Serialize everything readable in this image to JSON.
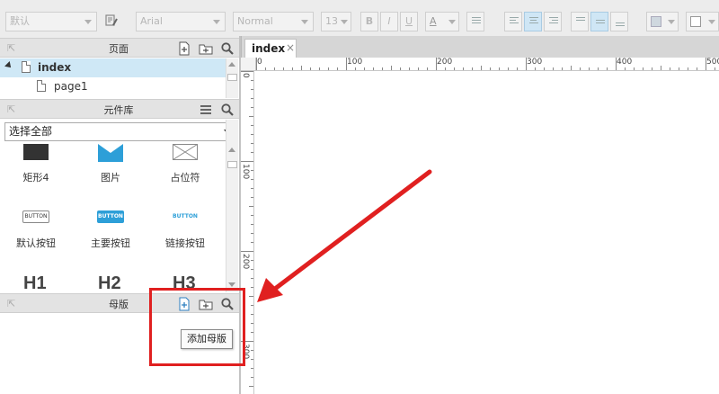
{
  "toolbar": {
    "style_select": "默认",
    "font_select": "Arial",
    "weight_select": "Normal",
    "size_select": "13",
    "bold": "B",
    "italic": "I",
    "underline": "U",
    "font_color": "A"
  },
  "pages_panel": {
    "title": "页面",
    "items": [
      {
        "label": "index",
        "selected": true
      },
      {
        "label": "page1",
        "selected": false
      }
    ]
  },
  "widgets_panel": {
    "title": "元件库",
    "library_select": "选择全部",
    "widgets": [
      {
        "label": "矩形4",
        "icon": "rectangle-icon"
      },
      {
        "label": "图片",
        "icon": "image-icon"
      },
      {
        "label": "占位符",
        "icon": "placeholder-icon"
      },
      {
        "label": "默认按钮",
        "icon": "default-button-icon",
        "preview": "BUTTON"
      },
      {
        "label": "主要按钮",
        "icon": "primary-button-icon",
        "preview": "BUTTON"
      },
      {
        "label": "链接按钮",
        "icon": "link-button-icon",
        "preview": "BUTTON"
      }
    ],
    "headings": [
      "H1",
      "H2",
      "H3"
    ]
  },
  "masters_panel": {
    "title": "母版",
    "tooltip": "添加母版"
  },
  "canvas": {
    "tab_label": "index",
    "tab_close": "×",
    "h_ruler_labels": [
      "0",
      "100",
      "200",
      "300",
      "400",
      "500"
    ],
    "v_ruler_labels": [
      "0",
      "100",
      "200",
      "300"
    ]
  },
  "colors": {
    "annotation": "#e02020",
    "selection": "#cfe8f6",
    "primary_button": "#2d9fd8"
  }
}
